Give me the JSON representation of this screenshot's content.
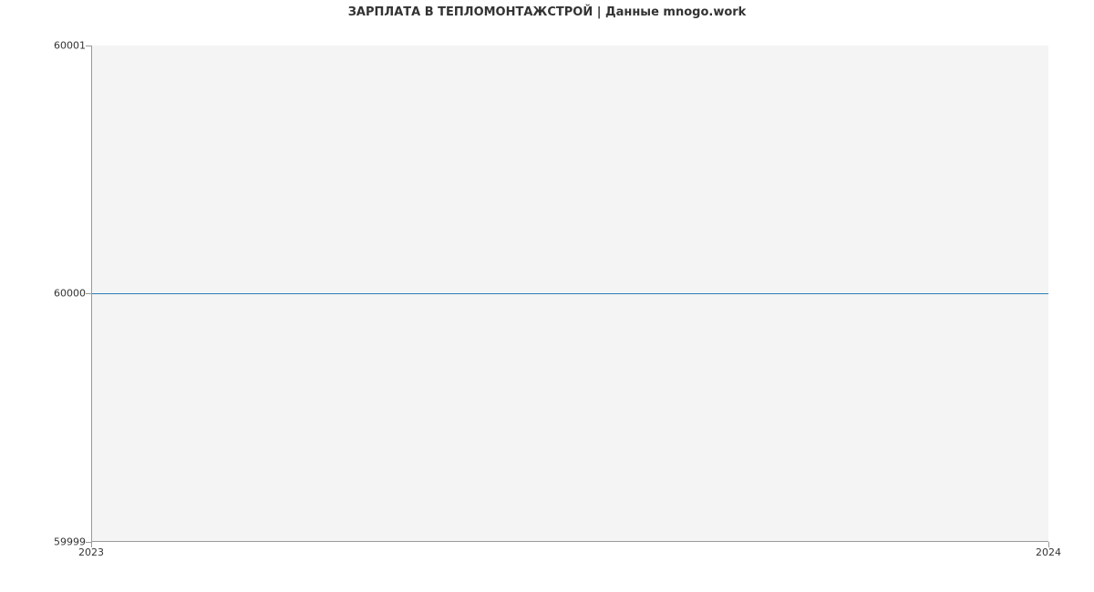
{
  "title": "ЗАРПЛАТА В ТЕПЛОМОНТАЖСТРОЙ | Данные mnogo.work",
  "y_ticks": [
    "59999",
    "60000",
    "60001"
  ],
  "x_ticks": [
    "2023",
    "2024"
  ],
  "chart_data": {
    "type": "line",
    "title": "ЗАРПЛАТА В ТЕПЛОМОНТАЖСТРОЙ | Данные mnogo.work",
    "xlabel": "",
    "ylabel": "",
    "x": [
      "2023",
      "2024"
    ],
    "y": [
      60000,
      60000
    ],
    "ylim": [
      59999,
      60001
    ],
    "xlim": [
      "2023",
      "2024"
    ]
  }
}
